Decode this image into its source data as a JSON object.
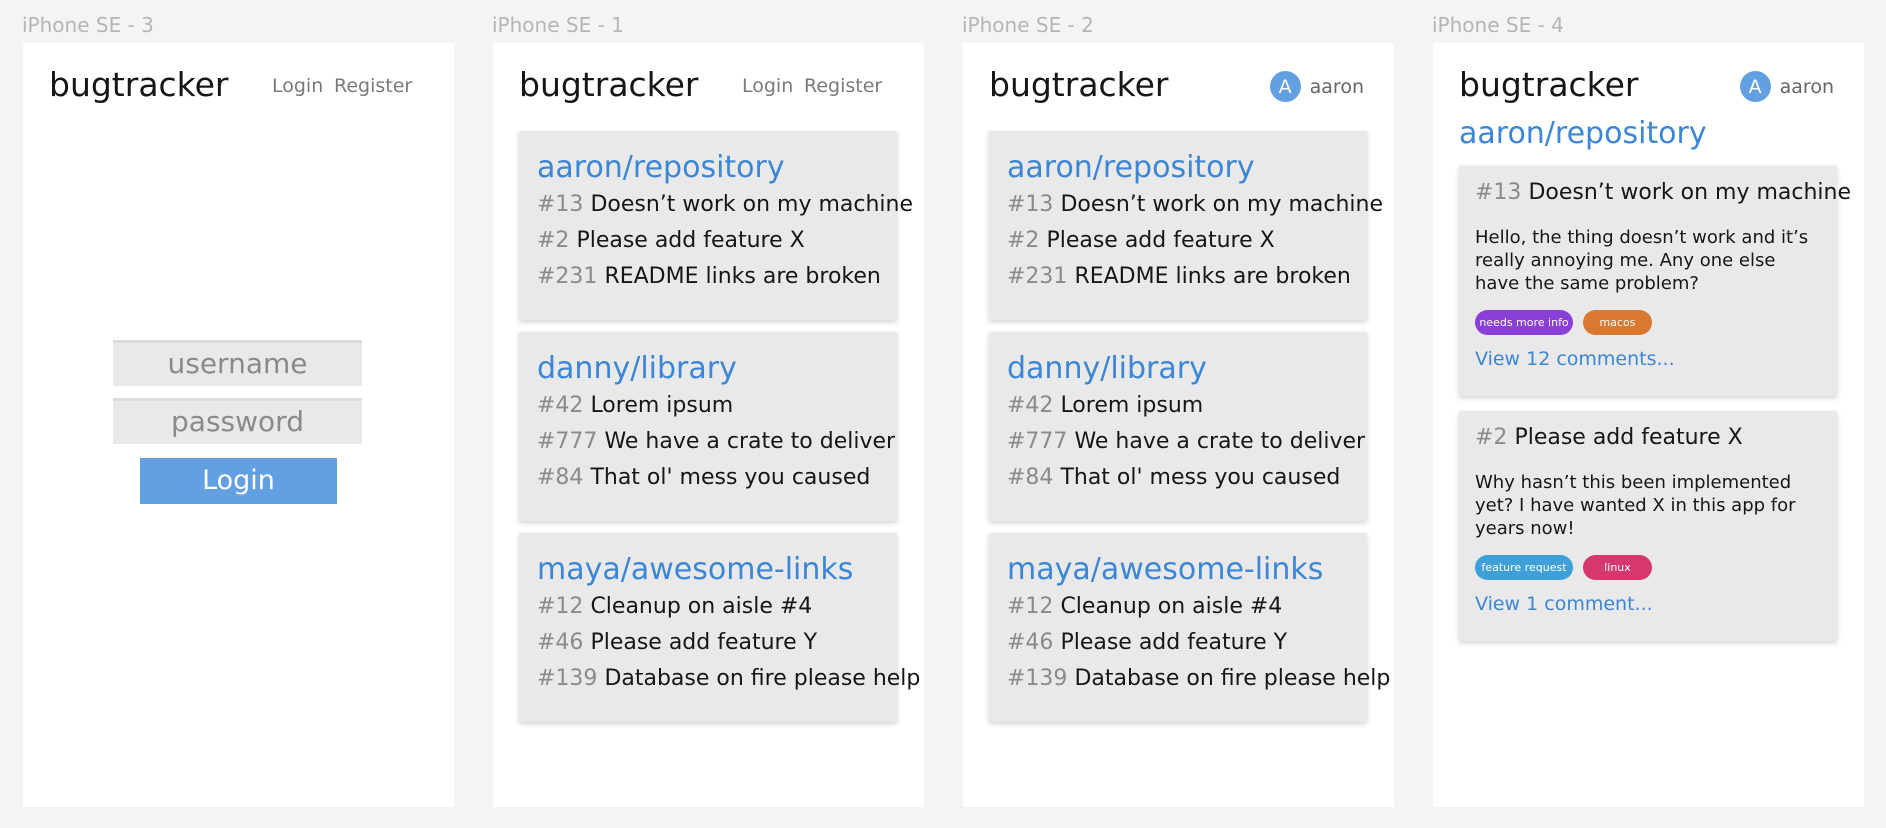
{
  "brand": "bugtracker",
  "colors": {
    "accent": "#63a0e2",
    "link": "#3b86d6",
    "card": "#e9e9e9",
    "canvas": "#f4f4f4"
  },
  "nav": {
    "login": "Login",
    "register": "Register"
  },
  "user": {
    "avatar_letter": "A",
    "name": "aaron"
  },
  "frames": [
    {
      "label": "iPhone SE - 3"
    },
    {
      "label": "iPhone SE - 1"
    },
    {
      "label": "iPhone SE - 2"
    },
    {
      "label": "iPhone SE - 4"
    }
  ],
  "login_form": {
    "username_placeholder": "username",
    "password_placeholder": "password",
    "submit_label": "Login"
  },
  "repositories": [
    {
      "name": "aaron/repository",
      "issues": [
        {
          "num": "#13",
          "title": "Doesn’t work on my machine"
        },
        {
          "num": "#2",
          "title": "Please add feature X"
        },
        {
          "num": "#231",
          "title": "README links are broken"
        }
      ]
    },
    {
      "name": "danny/library",
      "issues": [
        {
          "num": "#42",
          "title": "Lorem ipsum"
        },
        {
          "num": "#777",
          "title": "We have a crate to deliver"
        },
        {
          "num": "#84",
          "title": "That ol' mess you caused"
        }
      ]
    },
    {
      "name": "maya/awesome-links",
      "issues": [
        {
          "num": "#12",
          "title": "Cleanup on aisle #4"
        },
        {
          "num": "#46",
          "title": "Please add feature Y"
        },
        {
          "num": "#139",
          "title": "Database on fire please help"
        }
      ]
    }
  ],
  "repo_detail": {
    "repo_name": "aaron/repository",
    "issues": [
      {
        "num": "#13",
        "title": "Doesn’t work on my machine",
        "body": "Hello, the thing doesn’t work and it’s really annoying me. Any one else have the same problem?",
        "tags": [
          {
            "label": "needs more info",
            "color": "#8a3fd8"
          },
          {
            "label": "macos",
            "color": "#d9782f"
          }
        ],
        "comments_link": "View 12 comments..."
      },
      {
        "num": "#2",
        "title": "Please add feature X",
        "body": "Why hasn’t this been implemented yet? I have wanted X in this app for years now!",
        "tags": [
          {
            "label": "feature request",
            "color": "#3f9fd9"
          },
          {
            "label": "linux",
            "color": "#d6386d"
          }
        ],
        "comments_link": "View 1 comment..."
      }
    ]
  }
}
